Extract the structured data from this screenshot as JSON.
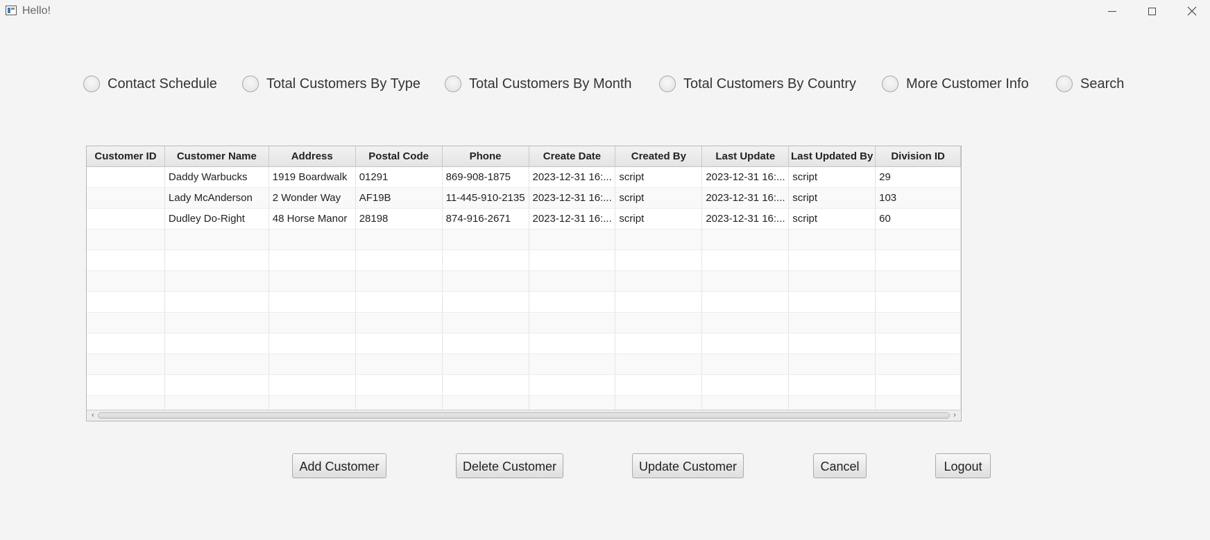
{
  "window": {
    "title": "Hello!",
    "app_icon": "java-app-icon",
    "controls": [
      "minimize",
      "maximize",
      "close"
    ]
  },
  "radio_options": [
    {
      "label": "Contact Schedule",
      "selected": false
    },
    {
      "label": "Total Customers By Type",
      "selected": false
    },
    {
      "label": "Total Customers By Month",
      "selected": false
    },
    {
      "label": "Total Customers By Country",
      "selected": false
    },
    {
      "label": "More Customer Info",
      "selected": false
    },
    {
      "label": "Search",
      "selected": false
    }
  ],
  "table": {
    "columns": [
      "Customer ID",
      "Customer Name",
      "Address",
      "Postal Code",
      "Phone",
      "Create Date",
      "Created By",
      "Last Update",
      "Last Updated By",
      "Division ID"
    ],
    "rows": [
      [
        "",
        "Daddy Warbucks",
        "1919 Boardwalk",
        "01291",
        "869-908-1875",
        "2023-12-31 16:...",
        "script",
        "2023-12-31 16:...",
        "script",
        "29"
      ],
      [
        "",
        "Lady McAnderson",
        "2 Wonder Way",
        "AF19B",
        "11-445-910-2135",
        "2023-12-31 16:...",
        "script",
        "2023-12-31 16:...",
        "script",
        "103"
      ],
      [
        "",
        "Dudley Do-Right",
        "48 Horse Manor",
        "28198",
        "874-916-2671",
        "2023-12-31 16:...",
        "script",
        "2023-12-31 16:...",
        "script",
        "60"
      ]
    ],
    "empty_rows": 9
  },
  "buttons": {
    "add": "Add Customer",
    "delete": "Delete Customer",
    "update": "Update Customer",
    "cancel": "Cancel",
    "logout": "Logout"
  }
}
